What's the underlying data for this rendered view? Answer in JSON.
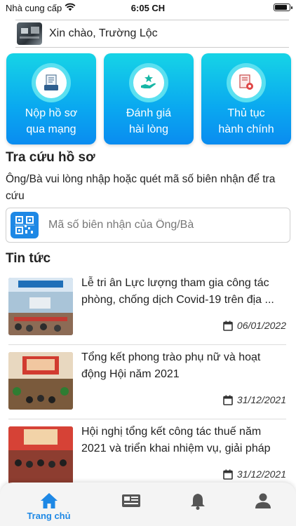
{
  "status_bar": {
    "carrier": "Nhà cung cấp",
    "time": "6:05 CH",
    "battery_level": 0.9
  },
  "greeting": {
    "text": "Xin chào, Trường Lộc"
  },
  "services": [
    {
      "label_line1": "Nộp hồ sơ",
      "label_line2": "qua mạng",
      "icon": "document-tray-icon"
    },
    {
      "label_line1": "Đánh giá",
      "label_line2": "hài lòng",
      "icon": "hand-star-icon"
    },
    {
      "label_line1": "Thủ tục",
      "label_line2": "hành chính",
      "icon": "document-gear-icon"
    }
  ],
  "lookup": {
    "title": "Tra cứu hồ sơ",
    "description": "Ông/Bà vui lòng nhập hoặc quét mã số biên nhận để tra cứu",
    "placeholder": "Mã số biên nhận của Ông/Bà",
    "value": ""
  },
  "news": {
    "title": "Tin tức",
    "items": [
      {
        "title": "Lễ tri ân Lực lượng tham gia công tác phòng, chống dịch Covid-19 trên địa ...",
        "date": "06/01/2022"
      },
      {
        "title": "Tổng kết phong trào phụ nữ và hoạt động Hội năm 2021",
        "date": "31/12/2021"
      },
      {
        "title": "Hội nghị tổng kết công tác thuế năm 2021 và triển khai nhiệm vụ, giải pháp ...",
        "date": "31/12/2021"
      }
    ]
  },
  "tabbar": {
    "active_label": "Trang chủ",
    "tabs": [
      "home-icon",
      "news-icon",
      "bell-icon",
      "user-icon"
    ],
    "active_color": "#1e88e5",
    "inactive_color": "#555555"
  }
}
